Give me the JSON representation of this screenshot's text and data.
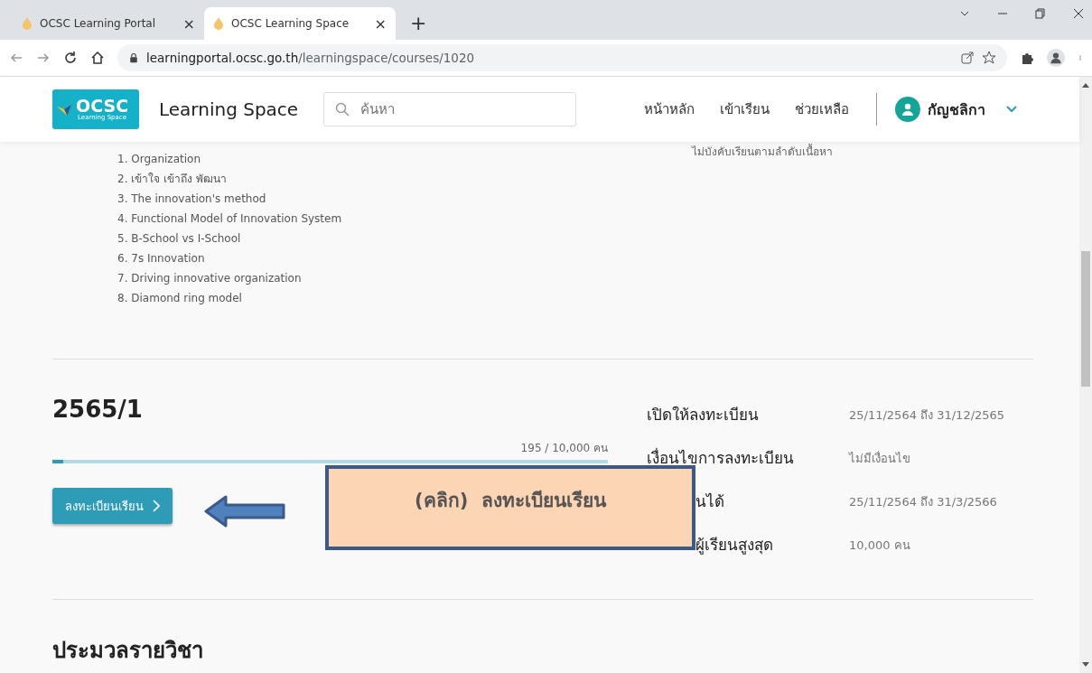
{
  "browser": {
    "tabs": [
      {
        "title": "OCSC Learning Portal",
        "close": "×",
        "selected": false
      },
      {
        "title": "OCSC Learning Space",
        "close": "×",
        "selected": true
      }
    ],
    "new_tab": "+",
    "url_host": "learningportal.ocsc.go.th",
    "url_path": "/learningspace/courses/1020"
  },
  "header": {
    "logo": "OCSC",
    "logo_sub": "Learning Space",
    "site_title": "Learning Space",
    "search": {
      "placeholder": "ค้นหา"
    },
    "nav": [
      "หน้าหลัก",
      "เข้าเรียน",
      "ช่วยเหลือ"
    ],
    "user": "กัญชลิกา"
  },
  "topics": [
    "1. Organization",
    "2. เข้าใจ เข้าถึง พัฒนา",
    "3. The innovation's method",
    "4. Functional Model of Innovation System",
    "5. B-School vs I-School",
    "6. 7s Innovation",
    "7. Driving innovative organization",
    "8. Diamond ring model"
  ],
  "order_note": "ไม่บังคับเรียนตามลำดับเนื้อหา",
  "session": {
    "title": "2565/1",
    "enrolled": "195 / 10,000 คน",
    "level": 0.02,
    "register_button": "ลงทะเบียนเรียน",
    "details": [
      {
        "label": "เปิดให้ลงทะเบียน",
        "value": "25/11/2564 ถึง 31/12/2565",
        "covered": false
      },
      {
        "label": "เงื่อนไขการลงทะเบียน",
        "value": "ไม่มีเงื่อนไข",
        "covered": false
      },
      {
        "label": "นได้",
        "value": "25/11/2564 ถึง 31/3/2566",
        "covered": true
      },
      {
        "label": "ผู้เรียนสูงสุด",
        "value": "10,000 คน",
        "covered": true
      }
    ]
  },
  "callout": "(คลิก)  ลงทะเบียนเรียน",
  "syllabus_title": "ประมวลรายวิชา"
}
